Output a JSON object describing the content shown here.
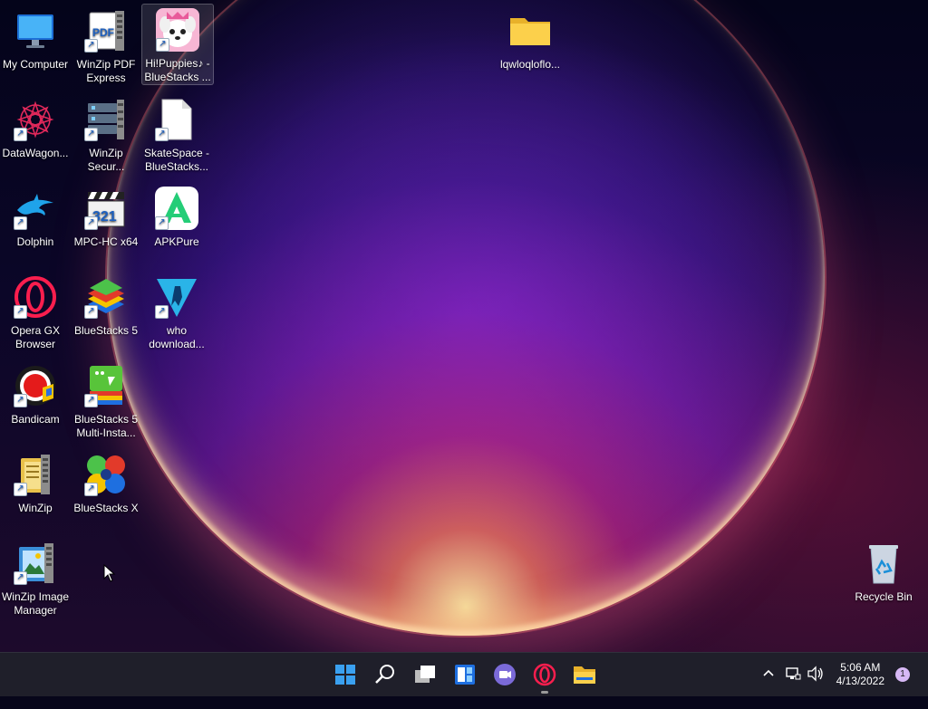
{
  "desktop": {
    "icons": [
      {
        "id": "my-computer",
        "label": "My Computer"
      },
      {
        "id": "datawagon",
        "label": "DataWagon..."
      },
      {
        "id": "dolphin",
        "label": "Dolphin"
      },
      {
        "id": "opera-gx",
        "label": "Opera GX Browser"
      },
      {
        "id": "bandicam",
        "label": "Bandicam"
      },
      {
        "id": "winzip",
        "label": "WinZip"
      },
      {
        "id": "winzip-image-manager",
        "label": "WinZip Image Manager"
      },
      {
        "id": "winzip-pdf-express",
        "label": "WinZip PDF Express"
      },
      {
        "id": "winzip-secure",
        "label": "WinZip Secur..."
      },
      {
        "id": "mpc-hc",
        "label": "MPC-HC x64"
      },
      {
        "id": "bluestacks-5",
        "label": "BlueStacks 5"
      },
      {
        "id": "bluestacks-multi",
        "label": "BlueStacks 5 Multi-Insta..."
      },
      {
        "id": "bluestacks-x",
        "label": "BlueStacks X"
      },
      {
        "id": "hi-puppies",
        "label": "Hi!Puppies♪ - BlueStacks ..."
      },
      {
        "id": "skatespace",
        "label": "SkateSpace - BlueStacks..."
      },
      {
        "id": "apkpure",
        "label": "APKPure"
      },
      {
        "id": "who-download",
        "label": "who download..."
      },
      {
        "id": "folder",
        "label": "lqwloqloflo..."
      },
      {
        "id": "recycle-bin",
        "label": "Recycle Bin"
      }
    ]
  },
  "taskbar": {
    "apps": [
      "start",
      "search",
      "task-view",
      "widgets",
      "chat",
      "opera",
      "file-explorer"
    ],
    "time": "5:06 AM",
    "date": "4/13/2022",
    "notifications": "1"
  },
  "colors": {
    "taskbar": "#1f1f2a",
    "accent": "#0078d4"
  }
}
